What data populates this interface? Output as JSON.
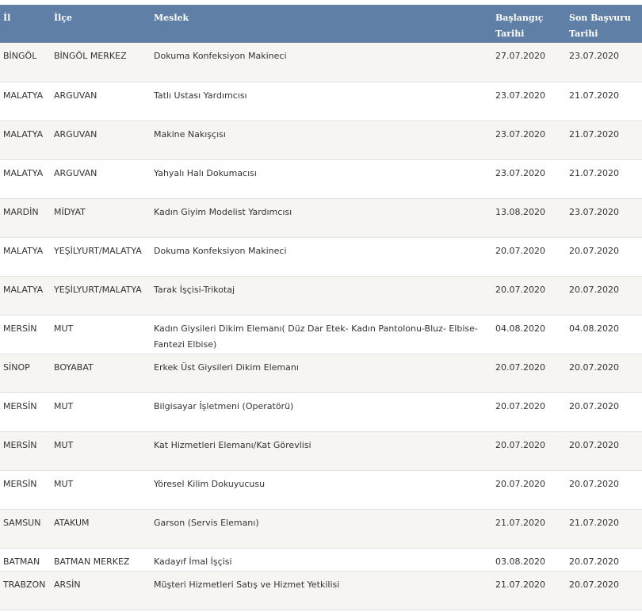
{
  "table": {
    "headers": {
      "il": "İl",
      "ilce": "İlçe",
      "meslek": "Meslek",
      "baslangic_line1": "Başlangıç",
      "baslangic_line2": "Tarihi",
      "son_line1": "Son Başvuru",
      "son_line2": "Tarihi"
    },
    "rows": [
      {
        "il": "BİNGÖL",
        "ilce": "BİNGÖL MERKEZ",
        "meslek": "Dokuma Konfeksiyon Makineci",
        "baslangic": "27.07.2020",
        "son": "23.07.2020"
      },
      {
        "il": "MALATYA",
        "ilce": "ARGUVAN",
        "meslek": "Tatlı Ustası Yardımcısı",
        "baslangic": "23.07.2020",
        "son": "21.07.2020"
      },
      {
        "il": "MALATYA",
        "ilce": "ARGUVAN",
        "meslek": "Makine Nakışçısı",
        "baslangic": "23.07.2020",
        "son": "21.07.2020"
      },
      {
        "il": "MALATYA",
        "ilce": "ARGUVAN",
        "meslek": "Yahyalı Halı Dokumacısı",
        "baslangic": "23.07.2020",
        "son": "21.07.2020"
      },
      {
        "il": "MARDİN",
        "ilce": "MİDYAT",
        "meslek": "Kadın Giyim Modelist Yardımcısı",
        "baslangic": "13.08.2020",
        "son": "23.07.2020"
      },
      {
        "il": "MALATYA",
        "ilce": "YEŞİLYURT/MALATYA",
        "meslek": "Dokuma Konfeksiyon Makineci",
        "baslangic": "20.07.2020",
        "son": "20.07.2020"
      },
      {
        "il": "MALATYA",
        "ilce": "YEŞİLYURT/MALATYA",
        "meslek": "Tarak İşçisi-Trikotaj",
        "baslangic": "20.07.2020",
        "son": "20.07.2020"
      },
      {
        "il": "MERSİN",
        "ilce": "MUT",
        "meslek": "Kadın Giysileri Dikim Elemanı( Düz Dar Etek- Kadın Pantolonu-Bluz- Elbise-Fantezi Elbise)",
        "baslangic": "04.08.2020",
        "son": "04.08.2020"
      },
      {
        "il": "SİNOP",
        "ilce": "BOYABAT",
        "meslek": "Erkek Üst Giysileri Dikim Elemanı",
        "baslangic": "20.07.2020",
        "son": "20.07.2020"
      },
      {
        "il": "MERSİN",
        "ilce": "MUT",
        "meslek": "Bilgisayar İşletmeni (Operatörü)",
        "baslangic": "20.07.2020",
        "son": "20.07.2020"
      },
      {
        "il": "MERSİN",
        "ilce": "MUT",
        "meslek": "Kat Hizmetleri Elemanı/Kat Görevlisi",
        "baslangic": "20.07.2020",
        "son": "20.07.2020"
      },
      {
        "il": "MERSİN",
        "ilce": "MUT",
        "meslek": "Yöresel Kilim Dokuyucusu",
        "baslangic": "20.07.2020",
        "son": "20.07.2020"
      },
      {
        "il": "SAMSUN",
        "ilce": "ATAKUM",
        "meslek": "Garson (Servis Elemanı)",
        "baslangic": "21.07.2020",
        "son": "21.07.2020"
      },
      {
        "il": "BATMAN",
        "ilce": "BATMAN MERKEZ",
        "meslek": "Kadayıf İmal İşçisi",
        "baslangic": "03.08.2020",
        "son": "20.07.2020"
      },
      {
        "il": "TRABZON",
        "ilce": "ARSİN",
        "meslek": "Müşteri Hizmetleri Satış ve Hizmet Yetkilisi",
        "baslangic": "21.07.2020",
        "son": "20.07.2020"
      }
    ]
  }
}
